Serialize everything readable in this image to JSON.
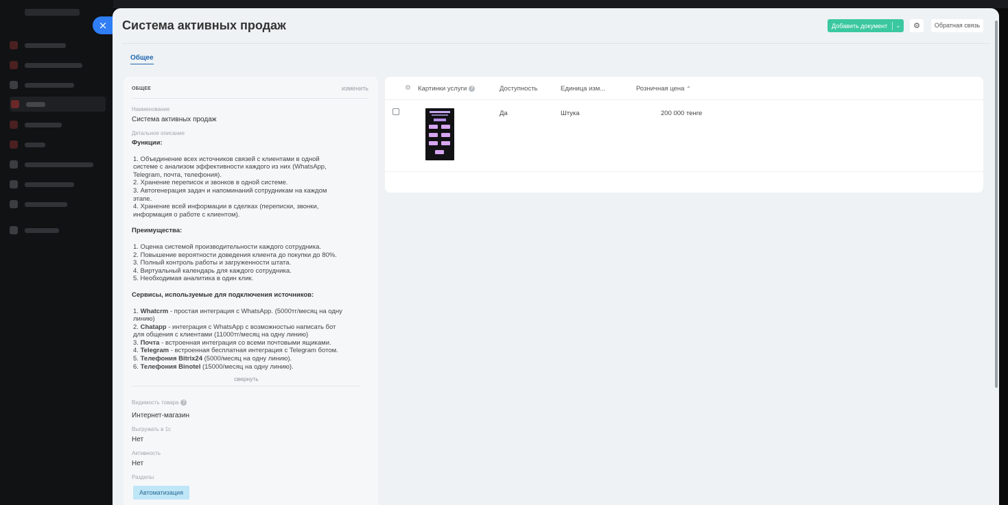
{
  "page": {
    "title": "Система активных продаж",
    "close_glyph": "×"
  },
  "header": {
    "add_document_label": "Добавить документ",
    "add_document_caret": "⌄",
    "settings_glyph": "⚙",
    "feedback_label": "Обратная связь"
  },
  "tabs": [
    {
      "label": "Общее",
      "active": true
    }
  ],
  "info_card": {
    "title": "ОБЩЕЕ",
    "edit_label": "изменить",
    "name_label": "Наименование",
    "name_value": "Система активных продаж",
    "description_label": "Детальное описание",
    "functions_heading": "Функции:",
    "functions": [
      "1. Объединение всех источников связей с клиентами в одной",
      "системе с анализом эффективности каждого из них (WhatsApp,",
      "Telegram, почта, телефония).",
      "2. Хранение переписок и звонков в одной системе.",
      "3. Автогенерация задач и напоминаний сотрудникам на каждом",
      "этапе.",
      "4. Хранение всей информации в сделках (переписки, звонки,",
      "информация о работе с клиентом)."
    ],
    "advantages_heading": "Преимущества:",
    "advantages": [
      "1. Оценка системой производительности каждого сотрудника.",
      "2. Повышение вероятности доведения клиента до покупки до 80%.",
      "3. Полный контроль работы и загруженности штата.",
      "4. Виртуальный календарь для каждого сотрудника.",
      "5. Необходимая аналитика в один клик."
    ],
    "services_heading": "Сервисы, используемые для подключения источников:",
    "services": [
      {
        "num": "1.",
        "bold": "Whatcrm",
        "rest": " - простая интеграция с WhatsApp. (5000тг/месяц на одну"
      },
      {
        "num": "",
        "bold": "",
        "rest": "линию)"
      },
      {
        "num": "2.",
        "bold": "Chatapp",
        "rest": " - интеграция с WhatsApp с возможностью написать бот"
      },
      {
        "num": "",
        "bold": "",
        "rest": "для общения с клиентами (11000тг/месяц на одну линию)"
      },
      {
        "num": "3.",
        "bold": "Почта",
        "rest": " - встроенная интеграция со всеми почтовыми ящиками."
      },
      {
        "num": "4.",
        "bold": "Telegram",
        "rest": " - встроенная бесплатная интеграция с Telegram ботом."
      },
      {
        "num": "5.",
        "bold": "Телефония Bitrix24",
        "rest": " (5000/месяц на одну линию)."
      },
      {
        "num": "6.",
        "bold": "Телефония Binotel",
        "rest": " (15000/месяц на одну линию)."
      }
    ],
    "collapse_label": "свернуть",
    "visibility_label": "Видимость товара",
    "visibility_value": "Интернет-магазин",
    "export_label": "Выгружать в 1с",
    "export_value": "Нет",
    "active_label": "Активность",
    "active_value": "Нет",
    "sections_label": "Разделы",
    "section_tag": "Автоматизация",
    "help_glyph": "?"
  },
  "table": {
    "settings_glyph": "⚙",
    "columns": {
      "images": "Картинки услуги",
      "availability": "Доступность",
      "unit": "Единица изм...",
      "price": "Розничная цена",
      "price_sort": "⌃"
    },
    "rows": [
      {
        "availability": "Да",
        "unit": "Штука",
        "price": "200 000 тенге"
      }
    ]
  },
  "colors": {
    "accent": "#2f7ef5",
    "add_button": "#3bc8a0",
    "tag_bg": "#bfe6f7"
  }
}
